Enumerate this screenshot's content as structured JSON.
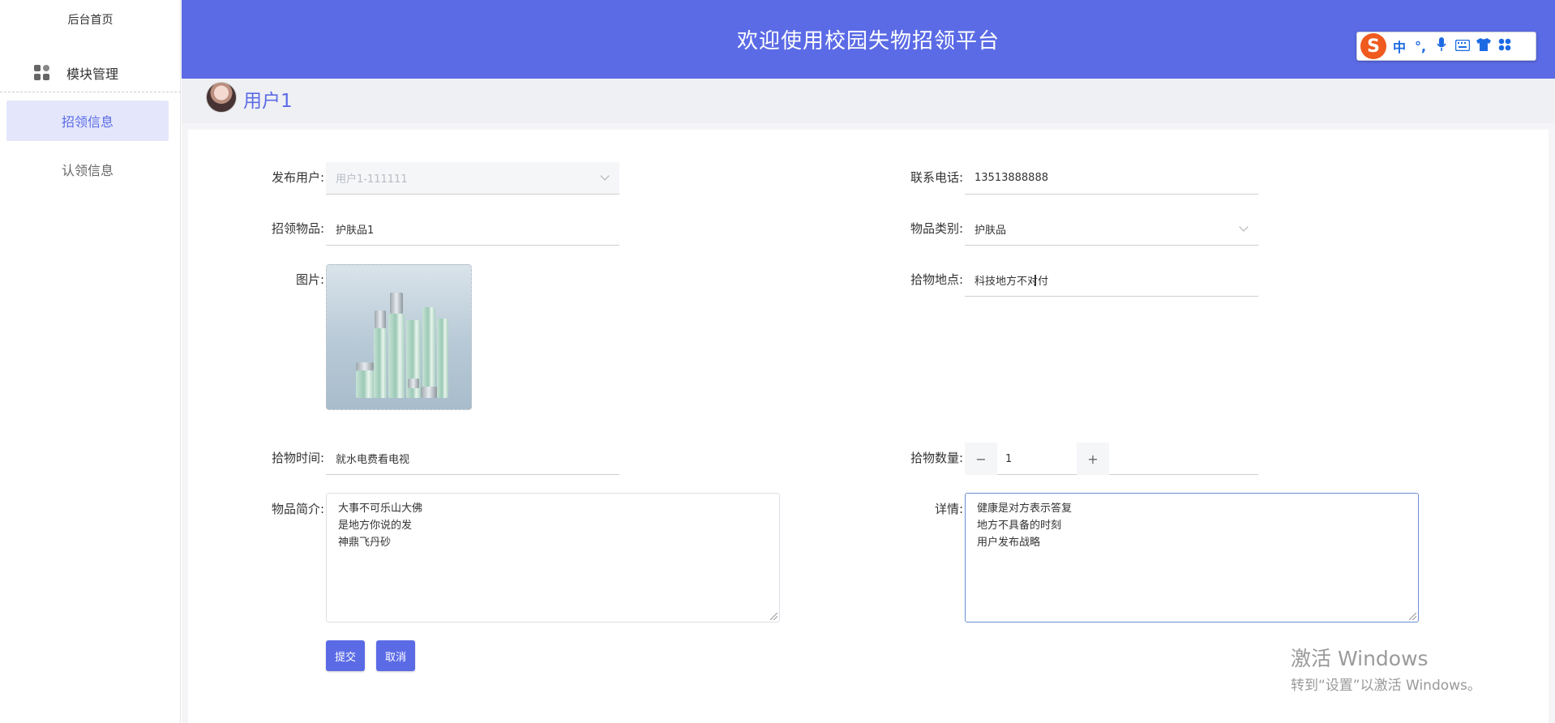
{
  "sidebar": {
    "home": "后台首页",
    "module": "模块管理",
    "items": [
      {
        "label": "招领信息"
      },
      {
        "label": "认领信息"
      }
    ]
  },
  "header": {
    "title": "欢迎使用校园失物招领平台"
  },
  "ime": {
    "logo": "S",
    "mode": "中",
    "punct": "°,"
  },
  "user": {
    "name": "用户1"
  },
  "form": {
    "publisher": {
      "label": "发布用户:",
      "value": "用户1-111111"
    },
    "phone": {
      "label": "联系电话:",
      "value": "13513888888"
    },
    "item": {
      "label": "招领物品:",
      "value": "护肤品1"
    },
    "category": {
      "label": "物品类别:",
      "value": "护肤品"
    },
    "image": {
      "label": "图片:"
    },
    "location": {
      "label": "拾物地点:",
      "value": "科技地方不对付"
    },
    "time": {
      "label": "拾物时间:",
      "value": "就水电费看电视"
    },
    "quantity": {
      "label": "拾物数量:",
      "value": "1",
      "minus": "−",
      "plus": "+"
    },
    "intro": {
      "label": "物品简介:",
      "lines": [
        "大事不可乐山大佛",
        "是地方你说的发",
        "神鼎飞丹砂"
      ]
    },
    "details": {
      "label": "详情:",
      "lines": [
        "健康是对方表示答复",
        "地方不具备的时刻",
        "用户发布战略"
      ]
    },
    "submit": "提交",
    "cancel": "取消"
  },
  "watermark": {
    "line1": "激活 Windows",
    "line2": "转到“设置”以激活 Windows。"
  }
}
